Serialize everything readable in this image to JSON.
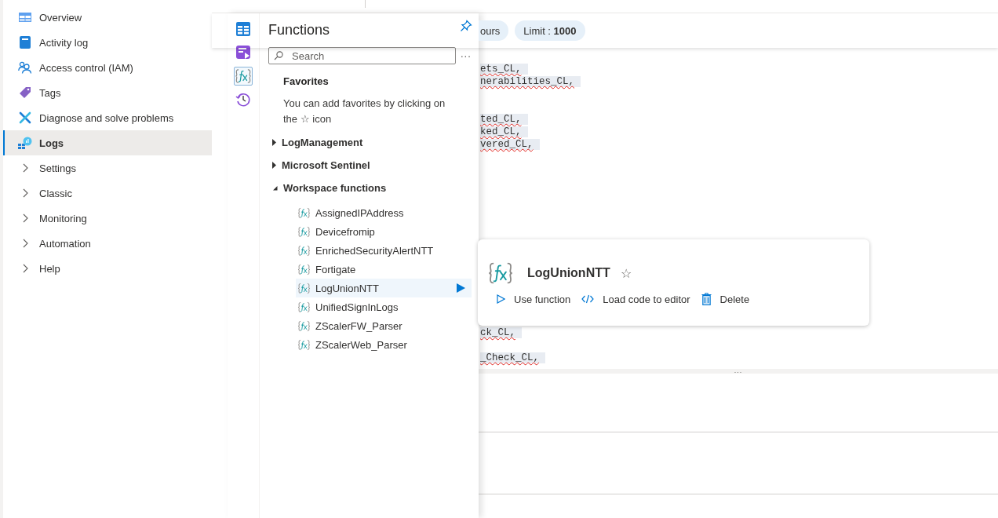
{
  "sidebar": {
    "items": [
      {
        "label": "Overview",
        "kind": "link",
        "selected": false
      },
      {
        "label": "Activity log",
        "kind": "link",
        "selected": false
      },
      {
        "label": "Access control (IAM)",
        "kind": "link",
        "selected": false
      },
      {
        "label": "Tags",
        "kind": "link",
        "selected": false
      },
      {
        "label": "Diagnose and solve problems",
        "kind": "link",
        "selected": false
      },
      {
        "label": "Logs",
        "kind": "link",
        "selected": true
      },
      {
        "label": "Settings",
        "kind": "group",
        "selected": false
      },
      {
        "label": "Classic",
        "kind": "group",
        "selected": false
      },
      {
        "label": "Monitoring",
        "kind": "group",
        "selected": false
      },
      {
        "label": "Automation",
        "kind": "group",
        "selected": false
      },
      {
        "label": "Help",
        "kind": "group",
        "selected": false
      }
    ]
  },
  "toolbar": {
    "pills": [
      "ours",
      "Limit : **1000**"
    ]
  },
  "editor": {
    "lines": [
      {
        "kind": "code",
        "text": "ets_CL,"
      },
      {
        "kind": "code",
        "text": "nerabilities_CL,"
      },
      {
        "kind": "blank"
      },
      {
        "kind": "blank"
      },
      {
        "kind": "code",
        "text": "ted_CL,"
      },
      {
        "kind": "code",
        "text": "ked_CL,"
      },
      {
        "kind": "code",
        "text": "vered_CL,"
      },
      {
        "kind": "blank"
      },
      {
        "kind": "blank"
      },
      {
        "kind": "blank"
      },
      {
        "kind": "blank"
      },
      {
        "kind": "blank"
      },
      {
        "kind": "blank"
      },
      {
        "kind": "blank"
      },
      {
        "kind": "blank"
      },
      {
        "kind": "blank"
      },
      {
        "kind": "blank"
      },
      {
        "kind": "blank"
      },
      {
        "kind": "blank"
      },
      {
        "kind": "blank"
      },
      {
        "kind": "blank"
      },
      {
        "kind": "code",
        "text": "ck_CL,"
      },
      {
        "kind": "blank"
      },
      {
        "kind": "code",
        "text": "_Check_CL,"
      }
    ],
    "splitter": "..."
  },
  "functions_panel": {
    "rail": [
      {
        "selected": false
      },
      {
        "selected": false
      },
      {
        "selected": true
      },
      {
        "selected": false
      }
    ],
    "title": "Functions",
    "search": {
      "placeholder": "Search"
    },
    "more": "...",
    "favorites": {
      "heading": "Favorites",
      "hint": "You can add favorites by clicking on the ☆ icon"
    },
    "groups": [
      {
        "label": "LogManagement",
        "expanded": false
      },
      {
        "label": "Microsoft Sentinel",
        "expanded": false
      },
      {
        "label": "Workspace functions",
        "expanded": true,
        "children": [
          {
            "label": "AssignedIPAddress",
            "selected": false
          },
          {
            "label": "Devicefromip",
            "selected": false
          },
          {
            "label": "EnrichedSecurityAlertNTT",
            "selected": false
          },
          {
            "label": "Fortigate",
            "selected": false
          },
          {
            "label": "LogUnionNTT",
            "selected": true
          },
          {
            "label": "UnifiedSignInLogs",
            "selected": false
          },
          {
            "label": "ZScalerFW_Parser",
            "selected": false
          },
          {
            "label": "ZScalerWeb_Parser",
            "selected": false
          }
        ]
      }
    ]
  },
  "function_card": {
    "title": "LogUnionNTT",
    "star": "☆",
    "actions": [
      "Use function",
      "Load code to editor",
      "Delete"
    ]
  }
}
